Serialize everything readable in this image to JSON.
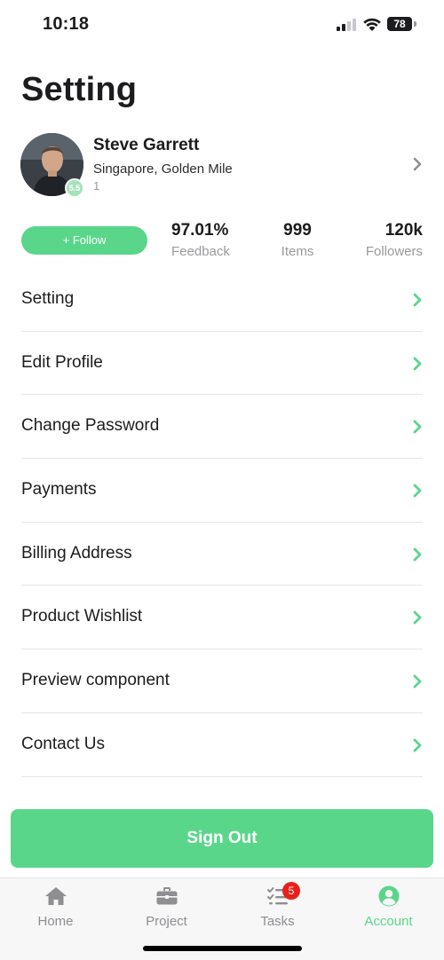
{
  "status_bar": {
    "time": "10:18",
    "battery": "78"
  },
  "page": {
    "title": "Setting"
  },
  "profile": {
    "name": "Steve Garrett",
    "location": "Singapore, Golden Mile",
    "subtext": "1",
    "badge": "5.5"
  },
  "stats": {
    "follow_label": "+ Follow",
    "feedback": {
      "value": "97.01%",
      "label": "Feedback"
    },
    "items": {
      "value": "999",
      "label": "Items"
    },
    "followers": {
      "value": "120k",
      "label": "Followers"
    }
  },
  "menu": [
    {
      "label": "Setting"
    },
    {
      "label": "Edit Profile"
    },
    {
      "label": "Change Password"
    },
    {
      "label": "Payments"
    },
    {
      "label": "Billing Address"
    },
    {
      "label": "Product Wishlist"
    },
    {
      "label": "Preview component"
    },
    {
      "label": "Contact Us"
    }
  ],
  "signout": {
    "label": "Sign Out"
  },
  "tabs": [
    {
      "label": "Home",
      "icon": "home-icon"
    },
    {
      "label": "Project",
      "icon": "briefcase-icon"
    },
    {
      "label": "Tasks",
      "icon": "task-list-icon",
      "badge": "5"
    },
    {
      "label": "Account",
      "icon": "account-icon",
      "active": true
    }
  ],
  "colors": {
    "accent": "#5ad68b",
    "badge_red": "#e8201a",
    "text": "#1c1c1e",
    "muted": "#9a9a9e"
  }
}
